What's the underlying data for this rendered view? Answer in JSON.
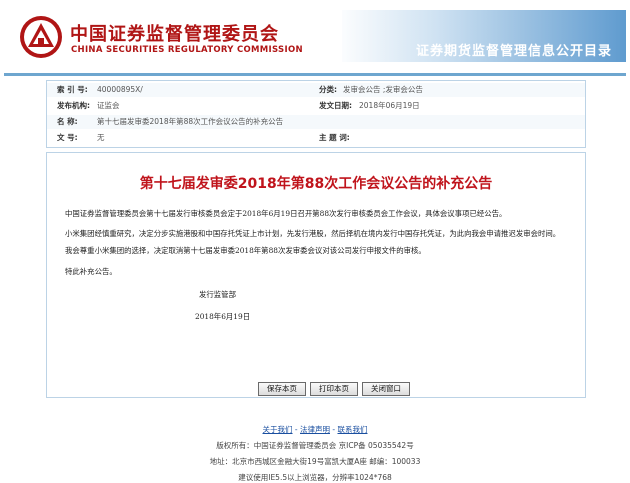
{
  "header": {
    "cn_name": "中国证券监督管理委员会",
    "en_name": "CHINA SECURITIES REGULATORY COMMISSION",
    "site_title": "证券期货监督管理信息公开目录"
  },
  "meta": {
    "index_label": "索  引  号:",
    "index_value": "40000895X/",
    "category_label": "分类:",
    "category_value": "发审会公告 ;发审会公告",
    "org_label": "发布机构:",
    "org_value": "证监会",
    "date_label": "发文日期:",
    "date_value": "2018年06月19日",
    "name_label": "名      称:",
    "name_value": "第十七届发审委2018年第88次工作会议公告的补充公告",
    "docno_label": "文      号:",
    "docno_value": "无",
    "keyword_label": "主 题 词:",
    "keyword_value": ""
  },
  "document": {
    "title": "第十七届发审委2018年第88次工作会议公告的补充公告",
    "para1": "中国证券监督管理委员会第十七届发行审核委员会定于2018年6月19日召开第88次发行审核委员会工作会议，具体会议事项已经公告。",
    "para2": "小米集团经慎重研究，决定分步实施港股和中国存托凭证上市计划，先发行港股，然后择机在境内发行中国存托凭证，为此向我会申请推迟发审会时间。我会尊重小米集团的选择，决定取消第十七届发审委2018年第88次发审委会议对该公司发行申报文件的审核。",
    "para3": "特此补充公告。",
    "sign_org": "发行监管部",
    "sign_date": "2018年6月19日"
  },
  "buttons": {
    "save": "保存本页",
    "print": "打印本页",
    "close": "关闭窗口"
  },
  "footer": {
    "about": "关于我们",
    "legal": "法律声明",
    "contact": "联系我们",
    "sep": " - ",
    "copyright": "版权所有：中国证券监督管理委员会  京ICP备 05035542号",
    "address": "地址：北京市西城区金融大街19号富凯大厦A座  邮编：100033",
    "browser": "建议使用IE5.5以上浏览器，分辨率1024*768"
  }
}
